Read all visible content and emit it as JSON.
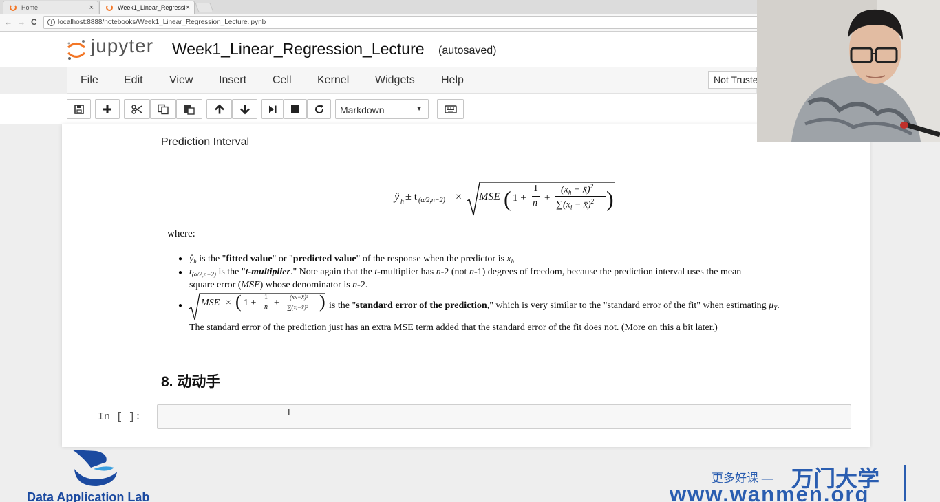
{
  "browser": {
    "tabs": [
      {
        "label": "Home",
        "close": "×"
      },
      {
        "label": "Week1_Linear_Regressi",
        "close": "×"
      }
    ],
    "nav": {
      "back": "←",
      "forward": "→",
      "reload": "C"
    },
    "url": "localhost:8888/notebooks/Week1_Linear_Regression_Lecture.ipynb"
  },
  "header": {
    "logo_text": "jupyter",
    "notebook_title": "Week1_Linear_Regression_Lecture",
    "save_status": "(autosaved)"
  },
  "menu": {
    "items": [
      "File",
      "Edit",
      "View",
      "Insert",
      "Cell",
      "Kernel",
      "Widgets",
      "Help"
    ],
    "trust_label": "Not Truste"
  },
  "toolbar": {
    "buttons": [
      "save-icon",
      "plus-icon",
      "scissors-icon",
      "copy-icon",
      "paste-icon",
      "arrow-up-icon",
      "arrow-down-icon",
      "skip-run-icon",
      "stop-icon",
      "restart-icon",
      "keyboard-icon"
    ],
    "cell_type": "Markdown",
    "dropdown_arrow": "▼"
  },
  "content": {
    "section_title": "Prediction Interval",
    "formula": {
      "yhat": "ŷ",
      "h": "h",
      "pm": " ± t",
      "t_sub": "(α/2,n−2)",
      "times": " × ",
      "mse": "MSE",
      "open": "(",
      "one_plus": "1 +",
      "num1": "1",
      "den1": "n",
      "plus": "+",
      "num2": "(x",
      "num2_b": " − x̄)",
      "num2_sup": "2",
      "den2": "∑(x",
      "den2_b": " − x̄)",
      "close": ")"
    },
    "where_label": "where:",
    "bullets": {
      "b1": {
        "yhat": "ŷ",
        "sub": "h",
        "t1": " is the \"",
        "bold1": "fitted value",
        "t2": "\" or \"",
        "bold2": "predicted value",
        "t3": "\" of the response when the predictor is ",
        "xh": "x",
        "xh_sub": "h"
      },
      "b2": {
        "t": "t",
        "t_sub": "(α/2,n−2)",
        "t1": " is the \"",
        "bold": "t-multiplier",
        "t2": ".\" Note again that the ",
        "t_italic": "t",
        "t3": "-multiplier has ",
        "n1": "n",
        "t4": "-2 (not ",
        "n2": "n",
        "t5": "-1) degrees of freedom, because the prediction interval uses the mean",
        "line2a": "square error (",
        "mse": "MSE",
        "line2b": ") whose denominator is ",
        "n3": "n",
        "line2c": "-2."
      },
      "b3": {
        "mse": "MSE",
        "rest": " × ( 1 + ",
        "f1n": "1",
        "f1d": "n",
        "plus": " + ",
        "f2n": "(xₕ−x̄)²",
        "f2d": "∑(xᵢ−x̄)²",
        "paren": " )",
        "t1": " is the \"",
        "bold": "standard error of the prediction",
        "t2": ",\" which is very similar to the \"standard error of the fit\" when estimating ",
        "mu": "μ",
        "mu_sub": "Y",
        "t3": ".",
        "line2": "The standard error of the prediction just has an extra MSE term added that the standard error of the fit does not. (More on this a bit later.)"
      }
    },
    "heading": "8. 动动手",
    "prompt": "In [ ]:"
  },
  "watermark": {
    "lab_name": "Data Application Lab",
    "cn_small": "更多好课 —",
    "cn_big": "万门大学",
    "url": "www.wanmen.org"
  }
}
